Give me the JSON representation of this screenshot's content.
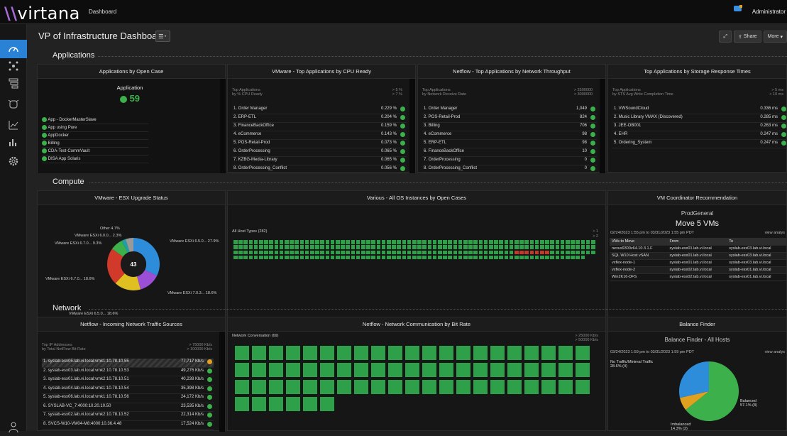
{
  "topbar": {
    "logo": "virtana",
    "breadcrumb": "Dashboard",
    "user": "Administrator"
  },
  "header": {
    "title": "VP of Infrastructure Dashboard",
    "share": "Share",
    "more": "More"
  },
  "sections": {
    "applications": "Applications",
    "compute": "Compute",
    "network": "Network"
  },
  "panel_open_case": {
    "title": "Applications by Open Case",
    "col": "Application",
    "count": "59",
    "items": [
      "App - DockerMasterSlave",
      "App using Pure",
      "AppDocker",
      "Billing",
      "CDA-Test-CommVault",
      "DISA App Solaris"
    ]
  },
  "panel_cpu_ready": {
    "title": "VMware - Top Applications by CPU Ready",
    "subhead1": "Top Applications",
    "subhead2": "by % CPU Ready",
    "thr1": "> 5 %",
    "thr2": "> 7 %",
    "rows": [
      {
        "name": "1. Order Manager",
        "val": "0.229 %"
      },
      {
        "name": "2. ERP-ETL",
        "val": "0.204 %"
      },
      {
        "name": "3. FinanceBackOffice",
        "val": "0.159 %"
      },
      {
        "name": "4. eCommerce",
        "val": "0.143 %"
      },
      {
        "name": "5. POS-Retail-Prod",
        "val": "0.073 %"
      },
      {
        "name": "6. OrderProcessing",
        "val": "0.065 %"
      },
      {
        "name": "7. KZBG-Media-Library",
        "val": "0.065 %"
      },
      {
        "name": "8. OrderProcessing_Conflict",
        "val": "0.056 %"
      }
    ]
  },
  "panel_netflow_tp": {
    "title": "Netflow - Top Applications by Network Throughput",
    "subhead1": "Top Applications",
    "subhead2": "by Network Receive Rate",
    "thr1": "> 2500000",
    "thr2": "> 3000000",
    "rows": [
      {
        "name": "1. Order Manager",
        "val": "1,049"
      },
      {
        "name": "2. POS-Retail-Prod",
        "val": "824"
      },
      {
        "name": "3. Billing",
        "val": "706"
      },
      {
        "name": "4. eCommerce",
        "val": "98"
      },
      {
        "name": "5. ERP-ETL",
        "val": "98"
      },
      {
        "name": "6. FinanceBackOffice",
        "val": "10"
      },
      {
        "name": "7. OrderProcessing",
        "val": "0"
      },
      {
        "name": "8. OrderProcessing_Conflict",
        "val": "0"
      }
    ]
  },
  "panel_storage": {
    "title": "Top Applications by Storage Response Times",
    "subhead1": "Top Applications",
    "subhead2": "by STS Avg Write Completion Time",
    "thr1": "> 5 ms",
    "thr2": "> 10 ms",
    "rows": [
      {
        "name": "1. VWSoundCloud",
        "val": "0.336 ms"
      },
      {
        "name": "2. Music Library VMAX (Discovered)",
        "val": "0.285 ms"
      },
      {
        "name": "3. JEE-OB001",
        "val": "0.263 ms"
      },
      {
        "name": "4. EHR",
        "val": "0.247 ms"
      },
      {
        "name": "5. Ordering_System",
        "val": "0.247 ms"
      }
    ]
  },
  "panel_esx": {
    "title": "VMware - ESX Upgrade Status",
    "center": "43",
    "labels": [
      "Other 4.7%",
      "VMware ESXi 6.0.0... 2.3%",
      "VMware ESXi 6.7.0... 9.3%",
      "VMware ESXi 6.5.0... 27.9%",
      "VMware ESXi 6.7.0... 18.6%",
      "VMware ESXi 7.0.3... 18.6%",
      "VMware ESXi 6.5.0... 18.6%"
    ]
  },
  "panel_os": {
    "title": "Various - All OS Instances by Open Cases",
    "label": "All Host Types (282)",
    "thr1": "> 1",
    "thr2": "> 2"
  },
  "panel_vmc": {
    "title": "VM Coordinator Recommendation",
    "sub": "ProdGeneral",
    "move": "Move 5 VMs",
    "range": "02/24/2023 1:55 pm to 03/31/2023 1:55 pm PDT",
    "link": "view analys",
    "headers": [
      "VMs to Move",
      "From",
      "To"
    ],
    "rows": [
      [
        "nexus9300v64.10.3.1.F",
        "syslab-esx01.lab.vi.local",
        "syslab-esx03.lab.vi.local"
      ],
      [
        "SQL W10 Host vSAN",
        "syslab-esx01.lab.vi.local",
        "syslab-esx03.lab.vi.local"
      ],
      [
        "vxflex-node-1",
        "syslab-esx01.lab.vi.local",
        "syslab-esx03.lab.vi.local"
      ],
      [
        "vxflex-node-2",
        "syslab-esx02.lab.vi.local",
        "syslab-esx01.lab.vi.local"
      ],
      [
        "Win2K16-DFS",
        "syslab-esx02.lab.vi.local",
        "syslab-esx01.lab.vi.local"
      ]
    ]
  },
  "panel_in_traffic": {
    "title": "Netflow - Incoming Network Traffic Sources",
    "subhead1": "Top IP Addresses",
    "subhead2": "by Total NetFlow Bit Rate",
    "thr1": "> 75000 Kb/s",
    "thr2": "> 100000 Kb/s",
    "rows": [
      {
        "name": "1. syslab-esx05.lab.vi.local:vmk1:10.78.10.55",
        "val": "77,717 Kb/s"
      },
      {
        "name": "2. syslab-esx03.lab.vi.local:vmk2:10.78.10.53",
        "val": "49,276 Kb/s"
      },
      {
        "name": "3. syslab-esx01.lab.vi.local:vmk2:10.78.10.51",
        "val": "40,238 Kb/s"
      },
      {
        "name": "4. syslab-esx04.lab.vi.local:vmk1:10.78.10.54",
        "val": "35,398 Kb/s"
      },
      {
        "name": "5. syslab-esx06.lab.vi.local:vmk1:10.78.10.56",
        "val": "24,172 Kb/s"
      },
      {
        "name": "6. SYSLAB-VC_7:4000:10.20.10.50",
        "val": "23,535 Kb/s"
      },
      {
        "name": "7. syslab-esx02.lab.vi.local:vmk2:10.78.10.52",
        "val": "22,314 Kb/s"
      },
      {
        "name": "8. SVCS-W10-VM04-M8:4000:10.36.4.48",
        "val": "17,524 Kb/s"
      }
    ]
  },
  "panel_bitrate": {
    "title": "Netflow - Network Communication by Bit Rate",
    "label": "Network Conversation (69)",
    "thr1": "> 25000 Kb/s",
    "thr2": "> 50000 Kb/s"
  },
  "panel_balance": {
    "title": "Balance Finder",
    "sub": "Balance Finder - All Hosts",
    "range": "03/24/2023 1:59 pm to 03/31/2023 1:59 pm PDT",
    "link": "view analys",
    "lbl_low1": "No Traffic/Minimal Traffic",
    "lbl_low2": "28.6% (4)",
    "lbl_bal1": "Balanced",
    "lbl_bal2": "57.1% (8)",
    "lbl_imb1": "Imbalanced",
    "lbl_imb2": "14.3% (2)"
  },
  "colors": {
    "accent": "#2a82d6",
    "ok": "#3cb04a",
    "warn": "#e0a020",
    "alert": "#c0392b"
  }
}
